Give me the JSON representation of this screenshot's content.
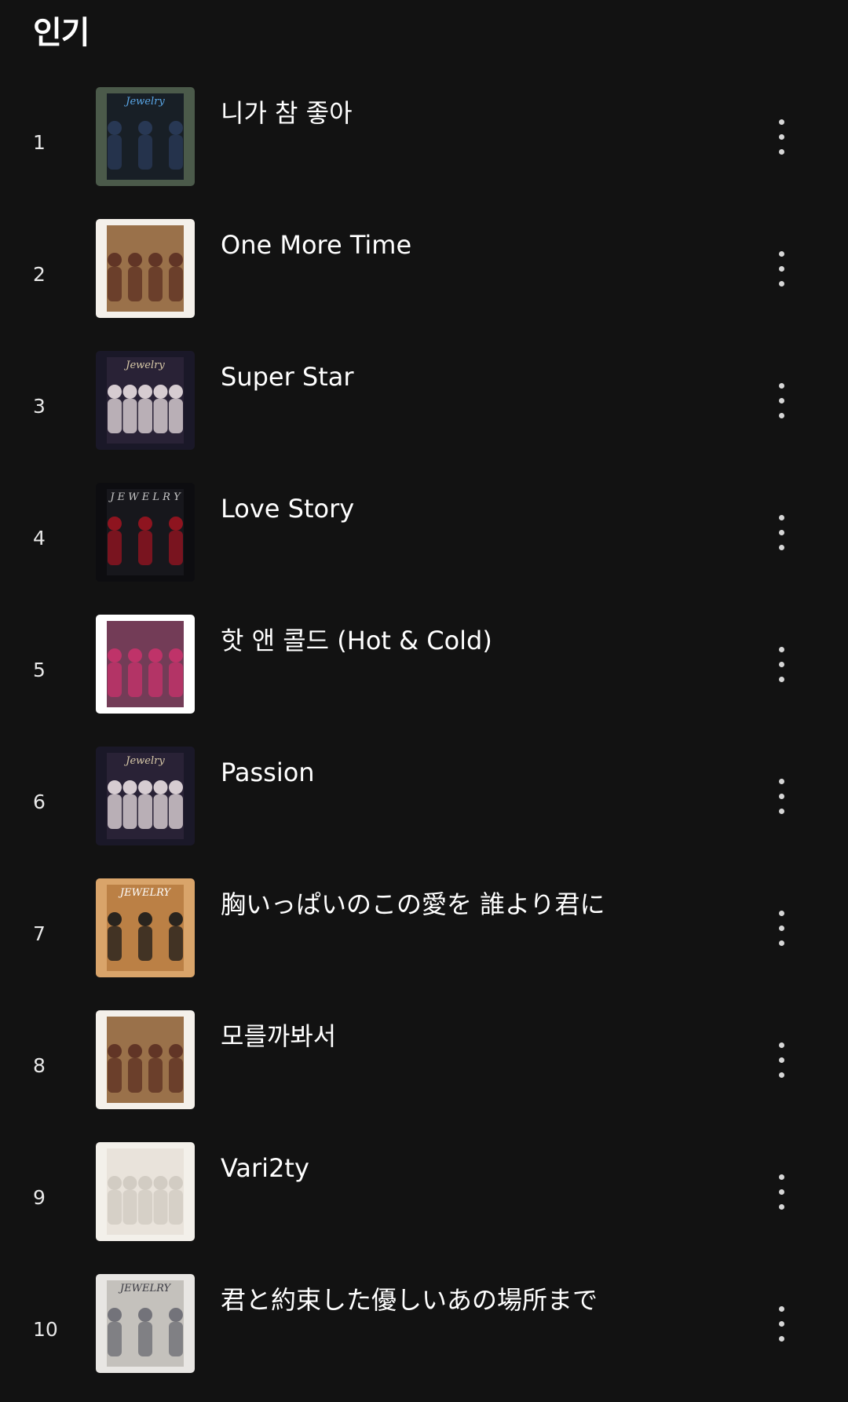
{
  "section": {
    "title": "인기"
  },
  "tracks": [
    {
      "rank": "1",
      "title": "니가 참 좋아",
      "more_icon": "more-vert-icon",
      "art": {
        "bg": "#4b5a4a",
        "accent": "#2a3b5a",
        "frame": "#0f1520",
        "label": "Jewelry",
        "label_color": "#5aa6e6"
      }
    },
    {
      "rank": "2",
      "title": "One More Time",
      "more_icon": "more-vert-icon",
      "art": {
        "bg": "#f4f0ea",
        "accent": "#5b2f22",
        "frame": "#8a5a2e",
        "label": "",
        "label_color": "#d9b36a"
      }
    },
    {
      "rank": "3",
      "title": "Super Star",
      "more_icon": "more-vert-icon",
      "art": {
        "bg": "#1a1828",
        "accent": "#e9dfe2",
        "frame": "#2d2438",
        "label": "Jewelry",
        "label_color": "#d8c9a8"
      }
    },
    {
      "rank": "4",
      "title": "Love Story",
      "more_icon": "more-vert-icon",
      "art": {
        "bg": "#0d0d10",
        "accent": "#9b1420",
        "frame": "#1a1a1f",
        "label": "J E W E L R Y",
        "label_color": "#c9c9c9"
      }
    },
    {
      "rank": "5",
      "title": "핫 앤 콜드 (Hot & Cold)",
      "more_icon": "more-vert-icon",
      "art": {
        "bg": "#ffffff",
        "accent": "#c8326b",
        "frame": "#5a1a3a",
        "label": "",
        "label_color": "#ffffff"
      }
    },
    {
      "rank": "6",
      "title": "Passion",
      "more_icon": "more-vert-icon",
      "art": {
        "bg": "#1a1828",
        "accent": "#e9dfe2",
        "frame": "#2d2438",
        "label": "Jewelry",
        "label_color": "#d8c9a8"
      }
    },
    {
      "rank": "7",
      "title": "胸いっぱいのこの愛を 誰より君に",
      "more_icon": "more-vert-icon",
      "art": {
        "bg": "#d9a46a",
        "accent": "#1a1a1a",
        "frame": "#b57a3e",
        "label": "JEWELRY",
        "label_color": "#ffffff"
      }
    },
    {
      "rank": "8",
      "title": "모를까봐서",
      "more_icon": "more-vert-icon",
      "art": {
        "bg": "#f4f0ea",
        "accent": "#5b2f22",
        "frame": "#8a5a2e",
        "label": "",
        "label_color": "#d9b36a"
      }
    },
    {
      "rank": "9",
      "title": "Vari2ty",
      "more_icon": "more-vert-icon",
      "art": {
        "bg": "#f3f0ea",
        "accent": "#cfc9c0",
        "frame": "#e6e1d8",
        "label": "",
        "label_color": "#8a8378"
      }
    },
    {
      "rank": "10",
      "title": "君と約束した優しいあの場所まで",
      "more_icon": "more-vert-icon",
      "art": {
        "bg": "#e8e6e3",
        "accent": "#6a6a72",
        "frame": "#bdbab5",
        "label": "JEWELRY",
        "label_color": "#3a3a42"
      }
    }
  ]
}
